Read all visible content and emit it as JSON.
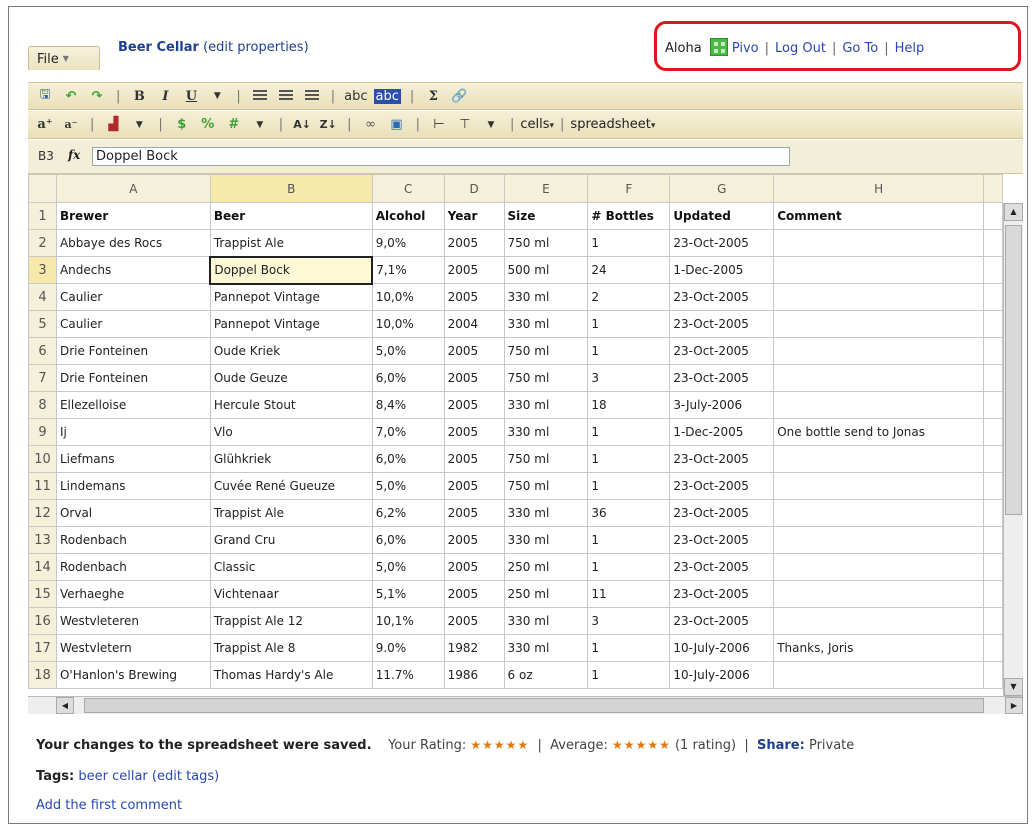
{
  "header": {
    "file_menu": "File",
    "doc_title": "Beer Cellar",
    "edit_properties": "(edit properties)"
  },
  "user_nav": {
    "greeting": "Aloha",
    "username": "Pivo",
    "log_out": "Log Out",
    "go_to": "Go To",
    "help": "Help",
    "highlight_color": "#e0141c"
  },
  "toolbar2": {
    "cells_menu": "cells",
    "spreadsheet_menu": "spreadsheet"
  },
  "formula_bar": {
    "cell_ref": "B3",
    "fx_label": "fx",
    "value": "Doppel Bock"
  },
  "grid": {
    "columns": [
      "A",
      "B",
      "C",
      "D",
      "E",
      "F",
      "G",
      "H"
    ],
    "selected_column": "B",
    "selected_row": 3,
    "rows": [
      {
        "n": "1",
        "cells": [
          "Brewer",
          "Beer",
          "Alcohol",
          "Year",
          "Size",
          "# Bottles",
          "Updated",
          "Comment"
        ]
      },
      {
        "n": "2",
        "cells": [
          "Abbaye des Rocs",
          "Trappist Ale",
          "9,0%",
          "2005",
          "750 ml",
          "1",
          "23-Oct-2005",
          ""
        ]
      },
      {
        "n": "3",
        "cells": [
          "Andechs",
          "Doppel Bock",
          "7,1%",
          "2005",
          "500 ml",
          "24",
          "1-Dec-2005",
          ""
        ]
      },
      {
        "n": "4",
        "cells": [
          "Caulier",
          "Pannepot Vintage",
          "10,0%",
          "2005",
          "330 ml",
          "2",
          "23-Oct-2005",
          ""
        ]
      },
      {
        "n": "5",
        "cells": [
          "Caulier",
          "Pannepot Vintage",
          "10,0%",
          "2004",
          "330 ml",
          "1",
          "23-Oct-2005",
          ""
        ]
      },
      {
        "n": "6",
        "cells": [
          "Drie Fonteinen",
          "Oude Kriek",
          "5,0%",
          "2005",
          "750 ml",
          "1",
          "23-Oct-2005",
          ""
        ]
      },
      {
        "n": "7",
        "cells": [
          "Drie Fonteinen",
          "Oude Geuze",
          "6,0%",
          "2005",
          "750 ml",
          "3",
          "23-Oct-2005",
          ""
        ]
      },
      {
        "n": "8",
        "cells": [
          "Ellezelloise",
          "Hercule Stout",
          "8,4%",
          "2005",
          "330 ml",
          "18",
          "3-July-2006",
          ""
        ]
      },
      {
        "n": "9",
        "cells": [
          "Ij",
          "Vlo",
          "7,0%",
          "2005",
          "330 ml",
          "1",
          "1-Dec-2005",
          "One bottle send to Jonas"
        ]
      },
      {
        "n": "10",
        "cells": [
          "Liefmans",
          "Glühkriek",
          "6,0%",
          "2005",
          "750 ml",
          "1",
          "23-Oct-2005",
          ""
        ]
      },
      {
        "n": "11",
        "cells": [
          "Lindemans",
          "Cuvée René Gueuze",
          "5,0%",
          "2005",
          "750 ml",
          "1",
          "23-Oct-2005",
          ""
        ]
      },
      {
        "n": "12",
        "cells": [
          "Orval",
          "Trappist Ale",
          "6,2%",
          "2005",
          "330 ml",
          "36",
          "23-Oct-2005",
          ""
        ]
      },
      {
        "n": "13",
        "cells": [
          "Rodenbach",
          "Grand Cru",
          "6,0%",
          "2005",
          "330 ml",
          "1",
          "23-Oct-2005",
          ""
        ]
      },
      {
        "n": "14",
        "cells": [
          "Rodenbach",
          "Classic",
          "5,0%",
          "2005",
          "250 ml",
          "1",
          "23-Oct-2005",
          ""
        ]
      },
      {
        "n": "15",
        "cells": [
          "Verhaeghe",
          "Vichtenaar",
          "5,1%",
          "2005",
          "250 ml",
          "11",
          "23-Oct-2005",
          ""
        ]
      },
      {
        "n": "16",
        "cells": [
          "Westvleteren",
          "Trappist Ale 12",
          "10,1%",
          "2005",
          "330 ml",
          "3",
          "23-Oct-2005",
          ""
        ]
      },
      {
        "n": "17",
        "cells": [
          "Westvletern",
          "Trappist Ale 8",
          "9.0%",
          "1982",
          "330 ml",
          "1",
          "10-July-2006",
          "Thanks, Joris"
        ]
      },
      {
        "n": "18",
        "cells": [
          "O'Hanlon's Brewing",
          "Thomas Hardy's Ale",
          "11.7%",
          "1986",
          "6 oz",
          "1",
          "10-July-2006",
          ""
        ]
      }
    ]
  },
  "footer": {
    "saved_msg": "Your changes to the spreadsheet were saved.",
    "your_rating_label": "Your Rating:",
    "your_rating_stars": "★★★★★",
    "average_label": "Average:",
    "average_stars": "★★★★★",
    "rating_count": "(1 rating)",
    "share_label": "Share:",
    "share_value": "Private",
    "tags_label": "Tags:",
    "tags": [
      "beer",
      "cellar"
    ],
    "edit_tags": "(edit tags)",
    "add_comment": "Add the first comment",
    "star_color": "#e2780e"
  }
}
